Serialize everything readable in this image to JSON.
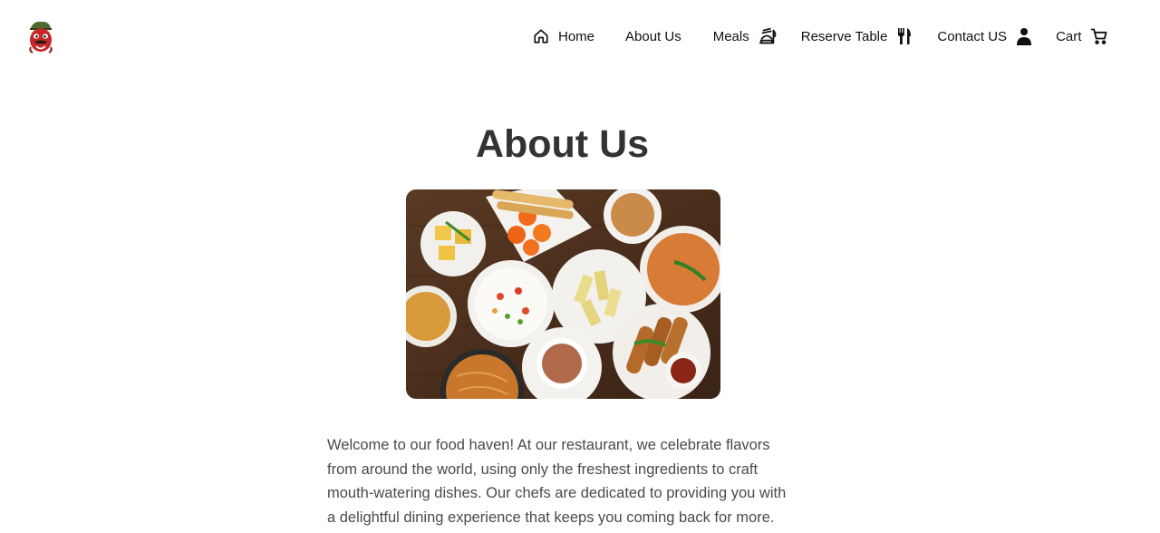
{
  "header": {
    "logo": {
      "icon": "chef-mascot-logo"
    },
    "nav": [
      {
        "label": "Home",
        "icon": "home-icon"
      },
      {
        "label": "About Us"
      },
      {
        "label": "Meals",
        "icon": "meals-icon"
      },
      {
        "label": "Reserve Table",
        "icon": "fork-knife-icon"
      },
      {
        "label": "Contact US",
        "icon": "person-icon"
      },
      {
        "label": "Cart",
        "icon": "cart-icon"
      }
    ]
  },
  "main": {
    "title": "About Us",
    "hero_image": {
      "subject": "platter of Indian snacks on a wooden table"
    },
    "intro": "Welcome to our food haven! At our restaurant, we celebrate flavors from around the world, using only the freshest ingredients to craft mouth-watering dishes. Our chefs are dedicated to providing you with a delightful dining experience that keeps you coming back for more."
  },
  "colors": {
    "title": "#333333",
    "body_text": "#4a4a4a",
    "nav_text": "#111111",
    "background": "#ffffff"
  }
}
